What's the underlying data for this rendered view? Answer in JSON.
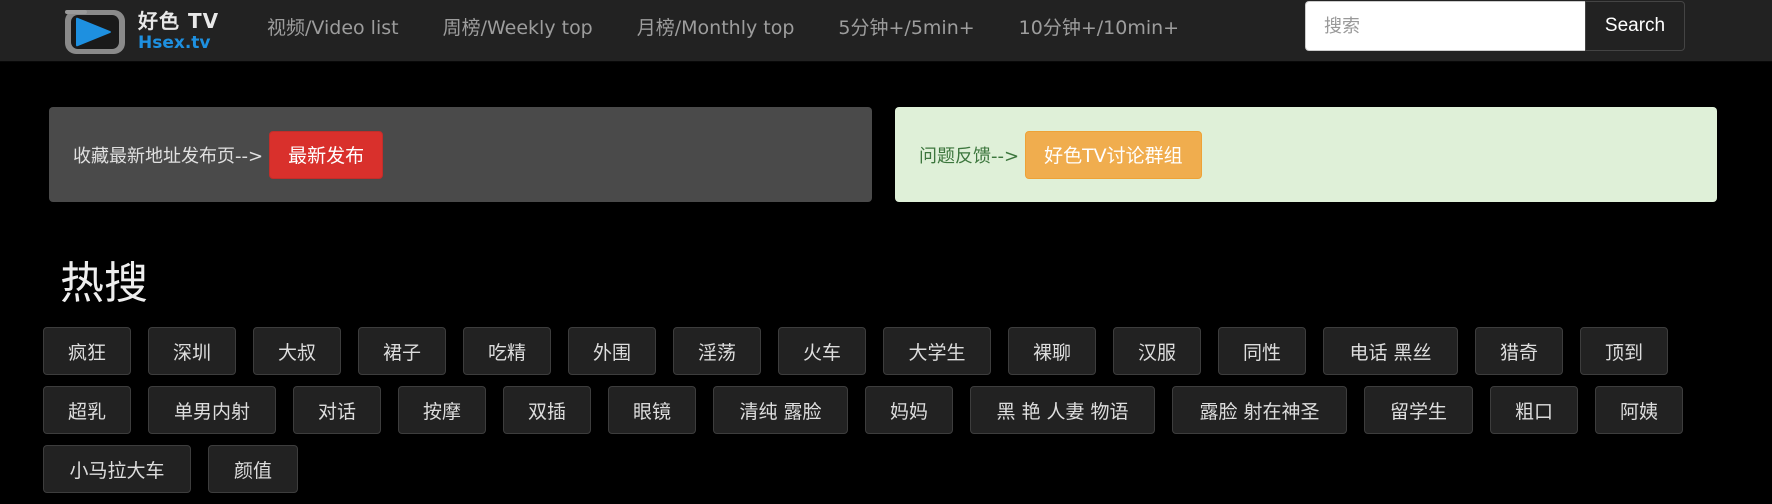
{
  "brand": {
    "name": "好色 TV",
    "domain": "Hsex.tv",
    "logo_icon": "play-tv-icon",
    "colors": {
      "logo_frame": "#8a8a8a",
      "logo_screen": "#1e90e0",
      "domain_text": "#1e90e0"
    }
  },
  "nav": {
    "links": [
      "视频/Video list",
      "周榜/Weekly top",
      "月榜/Monthly top",
      "5分钟+/5min+",
      "10分钟+/10min+"
    ]
  },
  "search": {
    "placeholder": "搜索",
    "button_label": "Search"
  },
  "notices": {
    "left": {
      "text": "收藏最新地址发布页-->",
      "button_label": "最新发布",
      "button_color": "#d9302c"
    },
    "right": {
      "text": "问题反馈-->",
      "button_label": "好色TV讨论群组",
      "button_color": "#f0ad4e"
    }
  },
  "hot": {
    "title": "热搜",
    "rows": [
      [
        "疯狂",
        "深圳",
        "大叔",
        "裙子",
        "吃精",
        "外围",
        "淫荡",
        "火车",
        "大学生",
        "裸聊",
        "汉服",
        "同性",
        "电话 黑丝",
        "猎奇",
        "顶到"
      ],
      [
        "超乳",
        "单男内射",
        "对话",
        "按摩",
        "双插",
        "眼镜",
        "清纯 露脸",
        "妈妈",
        "黑 艳 人妻 物语",
        "露脸 射在神圣",
        "留学生",
        "粗口",
        "阿姨"
      ],
      [
        "小马拉大车",
        "颜值"
      ]
    ]
  }
}
